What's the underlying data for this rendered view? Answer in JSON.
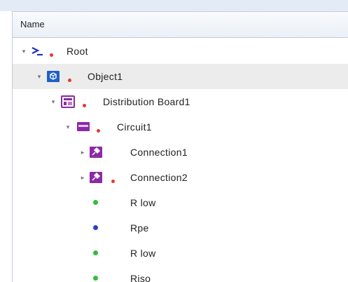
{
  "header": {
    "column_name": "Name"
  },
  "colors": {
    "green_status": "#2fbf3a",
    "blue_status": "#2a3fc6",
    "red_marker": "#e23a2b",
    "purple": "#8b2aa6",
    "blue_icon": "#1f5fc6"
  },
  "tree": {
    "root": "Root",
    "object": "Object1",
    "distribution_board": "Distribution Board1",
    "circuit": "Circuit1",
    "connection1": "Connection1",
    "connection2": "Connection2",
    "measurements": [
      "R low",
      "Rpe",
      "R low",
      "Riso"
    ]
  }
}
